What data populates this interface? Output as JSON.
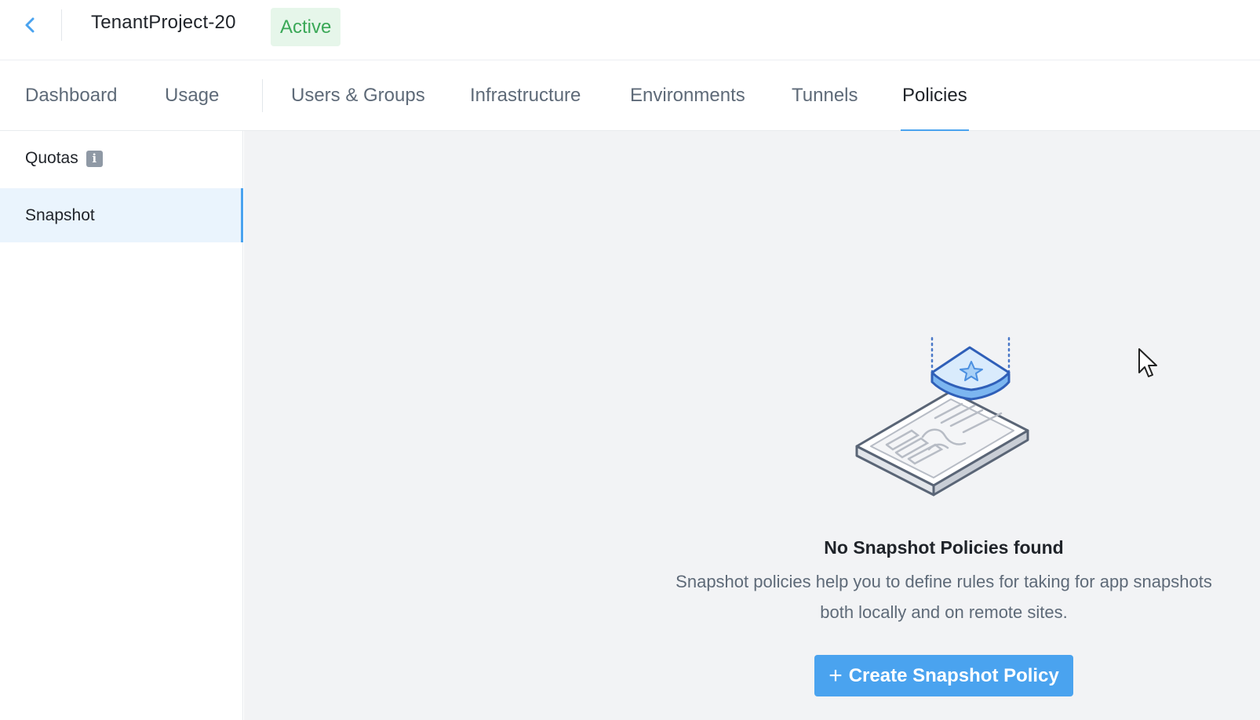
{
  "header": {
    "project_name": "TenantProject-20",
    "status": "Active"
  },
  "tabs": [
    {
      "label": "Dashboard",
      "active": false
    },
    {
      "label": "Usage",
      "active": false
    },
    {
      "label": "Users & Groups",
      "active": false
    },
    {
      "label": "Infrastructure",
      "active": false
    },
    {
      "label": "Environments",
      "active": false
    },
    {
      "label": "Tunnels",
      "active": false
    },
    {
      "label": "Policies",
      "active": true
    }
  ],
  "sidebar": {
    "items": [
      {
        "label": "Quotas",
        "icon": "info-icon",
        "active": false
      },
      {
        "label": "Snapshot",
        "active": true
      }
    ]
  },
  "empty_state": {
    "title": "No Snapshot Policies found",
    "description": "Snapshot policies help you to define rules for taking for app snapshots both locally and on remote sites.",
    "button_label": "Create Snapshot Policy",
    "button_icon": "plus-icon"
  },
  "colors": {
    "accent": "#4aa3ef",
    "status_green": "#3aa857",
    "status_bg": "#e6f6ea",
    "content_bg": "#f2f3f5"
  }
}
